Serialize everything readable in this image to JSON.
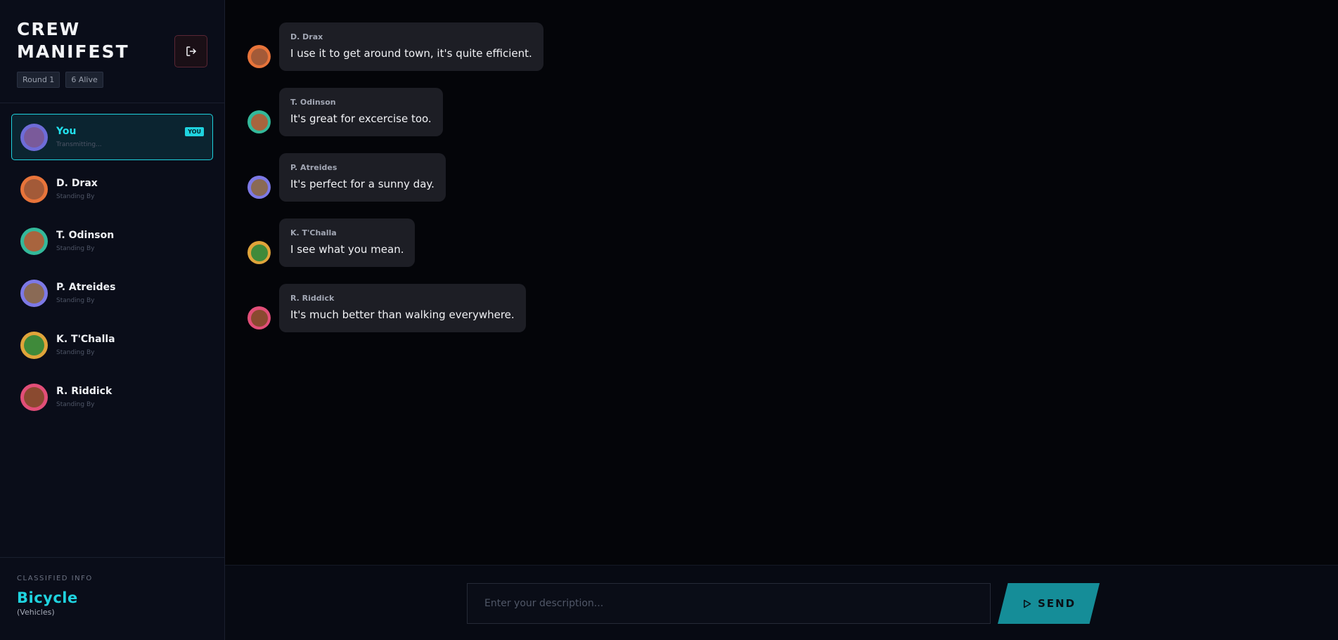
{
  "sidebar": {
    "title": "CREW MANIFEST",
    "badges": {
      "round": "Round 1",
      "alive": "6 Alive"
    },
    "logout_icon": "logout-icon",
    "crew": [
      {
        "name": "You",
        "status": "Transmitting...",
        "tag": "YOU",
        "ring": "#6e6cd8",
        "face": "#7a5a9a",
        "active": true
      },
      {
        "name": "D. Drax",
        "status": "Standing By",
        "ring": "#e8743a",
        "face": "#a35a38"
      },
      {
        "name": "T. Odinson",
        "status": "Standing By",
        "ring": "#33b99a",
        "face": "#a8643e"
      },
      {
        "name": "P. Atreides",
        "status": "Standing By",
        "ring": "#7d79e6",
        "face": "#8a6a55"
      },
      {
        "name": "K. T'Challa",
        "status": "Standing By",
        "ring": "#e0a43a",
        "face": "#3f8a3a"
      },
      {
        "name": "R. Riddick",
        "status": "Standing By",
        "ring": "#e24e78",
        "face": "#8a4a30"
      }
    ],
    "footer": {
      "label": "CLASSIFIED INFO",
      "word": "Bicycle",
      "category": "(Vehicles)"
    }
  },
  "messages": [
    {
      "author": "D. Drax",
      "text": "I use it to get around town, it's quite efficient.",
      "ring": "#e8743a",
      "face": "#a35a38"
    },
    {
      "author": "T. Odinson",
      "text": "It's great for excercise too.",
      "ring": "#33b99a",
      "face": "#a8643e"
    },
    {
      "author": "P. Atreides",
      "text": "It's perfect for a sunny day.",
      "ring": "#7d79e6",
      "face": "#8a6a55"
    },
    {
      "author": "K. T'Challa",
      "text": "I see what you mean.",
      "ring": "#e0a43a",
      "face": "#3f8a3a"
    },
    {
      "author": "R. Riddick",
      "text": "It's much better than walking everywhere.",
      "ring": "#e24e78",
      "face": "#8a4a30"
    }
  ],
  "composer": {
    "placeholder": "Enter your description...",
    "value": "",
    "send_label": "SEND",
    "send_icon": "play-icon"
  },
  "colors": {
    "accent": "#1fd3df",
    "send": "#158d98",
    "logout_border": "#5a2634"
  }
}
